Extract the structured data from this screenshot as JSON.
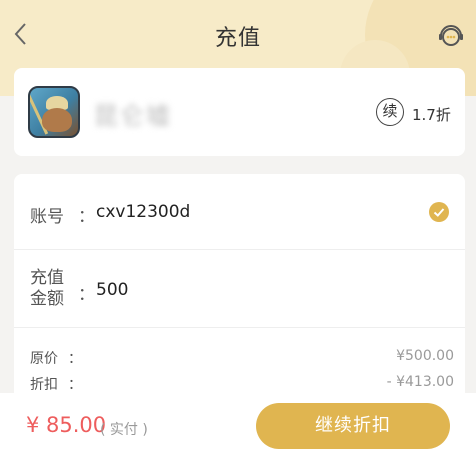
{
  "header": {
    "title": "充值",
    "back_icon": "chevron-left-icon",
    "service_icon": "customer-service-icon",
    "background_color": "#f7ebc8"
  },
  "game": {
    "name": "昆仑墟",
    "renew_badge": "续",
    "discount": "1.7折"
  },
  "form": {
    "account_label": "账号",
    "account_colon": "：",
    "account_value": "cxv12300d",
    "amount_label": "充值金额",
    "amount_colon": "：",
    "amount_value": "500",
    "check_icon": "check-circle-icon",
    "accent_color": "#e0b550"
  },
  "pricing": {
    "original_label": "原价",
    "original_colon": "：",
    "original_value": "¥500.00",
    "discount_label": "折扣",
    "discount_colon": "：",
    "discount_value": "- ¥413.00"
  },
  "footer": {
    "pay_amount": "¥ 85.00",
    "pay_note": "( 实付 )",
    "button_label": "继续折扣",
    "button_color": "#e0b550",
    "price_color": "#ee5d5d"
  }
}
